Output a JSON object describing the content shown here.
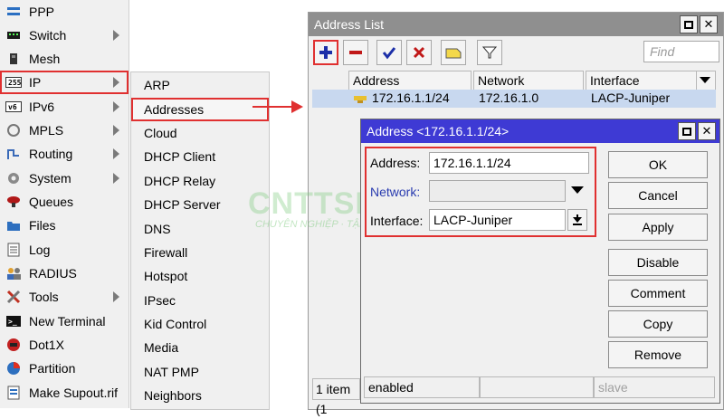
{
  "menu": {
    "items": [
      {
        "label": "PPP",
        "icon": "ppp-icon",
        "arrow": false
      },
      {
        "label": "Switch",
        "icon": "switch-icon",
        "arrow": true
      },
      {
        "label": "Mesh",
        "icon": "mesh-icon",
        "arrow": false
      },
      {
        "label": "IP",
        "icon": "ip-icon",
        "arrow": true
      },
      {
        "label": "IPv6",
        "icon": "ipv6-icon",
        "arrow": true
      },
      {
        "label": "MPLS",
        "icon": "mpls-icon",
        "arrow": true
      },
      {
        "label": "Routing",
        "icon": "routing-icon",
        "arrow": true
      },
      {
        "label": "System",
        "icon": "system-gear-icon",
        "arrow": true
      },
      {
        "label": "Queues",
        "icon": "queues-icon",
        "arrow": false
      },
      {
        "label": "Files",
        "icon": "files-folder-icon",
        "arrow": false
      },
      {
        "label": "Log",
        "icon": "log-icon",
        "arrow": false
      },
      {
        "label": "RADIUS",
        "icon": "radius-users-icon",
        "arrow": false
      },
      {
        "label": "Tools",
        "icon": "tools-icon",
        "arrow": true
      },
      {
        "label": "New Terminal",
        "icon": "terminal-icon",
        "arrow": false
      },
      {
        "label": "Dot1X",
        "icon": "dot1x-icon",
        "arrow": false
      },
      {
        "label": "Partition",
        "icon": "partition-pie-icon",
        "arrow": false
      },
      {
        "label": "Make Supout.rif",
        "icon": "supout-icon",
        "arrow": false
      }
    ],
    "selected": "IP"
  },
  "submenu": {
    "items": [
      "ARP",
      "Addresses",
      "Cloud",
      "DHCP Client",
      "DHCP Relay",
      "DHCP Server",
      "DNS",
      "Firewall",
      "Hotspot",
      "IPsec",
      "Kid Control",
      "Media",
      "NAT PMP",
      "Neighbors"
    ],
    "highlighted": "Addresses"
  },
  "address_list": {
    "title": "Address List",
    "find_placeholder": "Find",
    "columns": [
      "Address",
      "Network",
      "Interface"
    ],
    "rows": [
      {
        "address": "172.16.1.1/24",
        "network": "172.16.1.0",
        "interface": "LACP-Juniper"
      }
    ],
    "status": "1 item (1"
  },
  "dialog": {
    "title": "Address <172.16.1.1/24>",
    "address_label": "Address:",
    "address_value": "172.16.1.1/24",
    "network_label": "Network:",
    "network_value": "",
    "interface_label": "Interface:",
    "interface_value": "LACP-Juniper",
    "buttons": [
      "OK",
      "Cancel",
      "Apply",
      "Disable",
      "Comment",
      "Copy",
      "Remove"
    ],
    "status_left": "enabled",
    "status_mid": "",
    "status_right": "slave"
  },
  "watermark": {
    "main": "CNTTSHOP.vn",
    "sub": "CHUYÊN NGHIỆP · TẬN TÂM"
  },
  "colors": {
    "highlight_red": "#e03030",
    "dialog_title": "#3e3ad4",
    "row_selected": "#c8d8ef",
    "menu_bg": "#f0f0f0"
  }
}
